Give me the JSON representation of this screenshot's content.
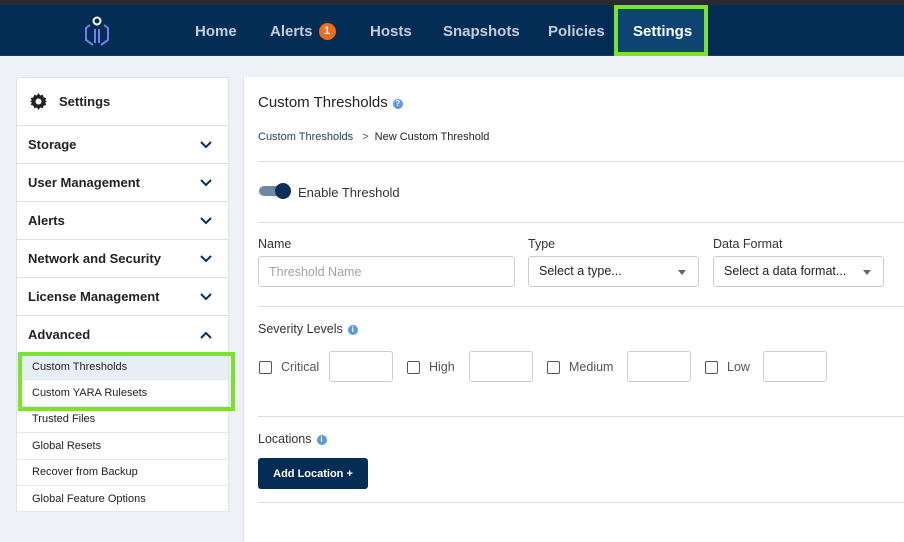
{
  "nav": {
    "items": [
      {
        "label": "Home"
      },
      {
        "label": "Alerts",
        "badge": "1"
      },
      {
        "label": "Hosts"
      },
      {
        "label": "Snapshots"
      },
      {
        "label": "Policies"
      },
      {
        "label": "Settings",
        "active": true
      }
    ]
  },
  "sidebar": {
    "title": "Settings",
    "sections": [
      {
        "label": "Storage"
      },
      {
        "label": "User Management"
      },
      {
        "label": "Alerts"
      },
      {
        "label": "Network and Security"
      },
      {
        "label": "License Management"
      },
      {
        "label": "Advanced"
      }
    ],
    "advanced_items": [
      {
        "label": "Custom Thresholds"
      },
      {
        "label": "Custom YARA Rulesets"
      },
      {
        "label": "Trusted Files"
      },
      {
        "label": "Global Resets"
      },
      {
        "label": "Recover from Backup"
      },
      {
        "label": "Global Feature Options"
      }
    ]
  },
  "main": {
    "title": "Custom Thresholds",
    "breadcrumb": {
      "link": "Custom Thresholds",
      "sep": ">",
      "current": "New Custom Threshold"
    },
    "enable_label": "Enable Threshold",
    "enabled": true,
    "name_label": "Name",
    "name_placeholder": "Threshold Name",
    "type_label": "Type",
    "type_value": "Select a type...",
    "format_label": "Data Format",
    "format_value": "Select a data format...",
    "severity_label": "Severity Levels",
    "severity": [
      {
        "label": "Critical"
      },
      {
        "label": "High"
      },
      {
        "label": "Medium"
      },
      {
        "label": "Low"
      }
    ],
    "locations_label": "Locations",
    "add_location": "Add Location  +"
  }
}
